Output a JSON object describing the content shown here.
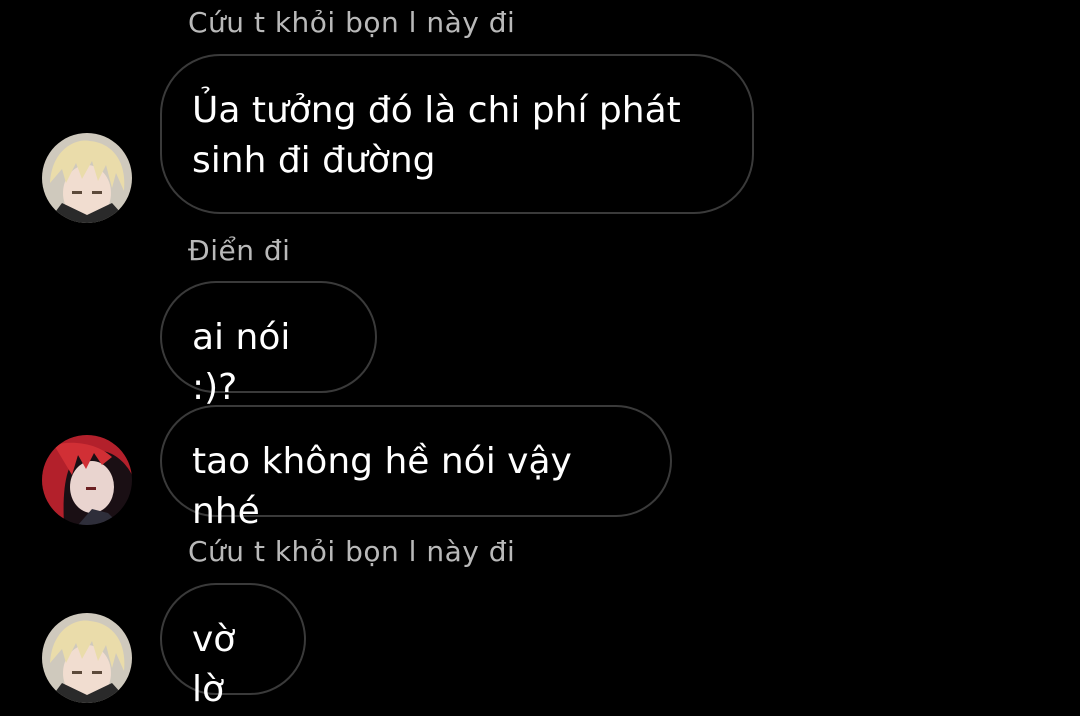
{
  "messages": [
    {
      "sender": "Cứu t khỏi bọn l này đi",
      "text": "Ủa tưởng đó là chi phí phát\nsinh đi đường",
      "avatar": "blonde-character-avatar"
    },
    {
      "sender": "Điển đi",
      "text": "ai nói :)?",
      "avatar": ""
    },
    {
      "sender": "",
      "text": "tao không hề nói vậy nhé",
      "avatar": "red-hair-character-avatar"
    },
    {
      "sender": "Cứu t khỏi bọn l này đi",
      "text": "vờ lờ",
      "avatar": "blonde-character-avatar"
    }
  ],
  "colors": {
    "background": "#000000",
    "bubble_border": "#3a3a3a",
    "sender_text": "#b9b9b9",
    "message_text": "#ffffff"
  }
}
